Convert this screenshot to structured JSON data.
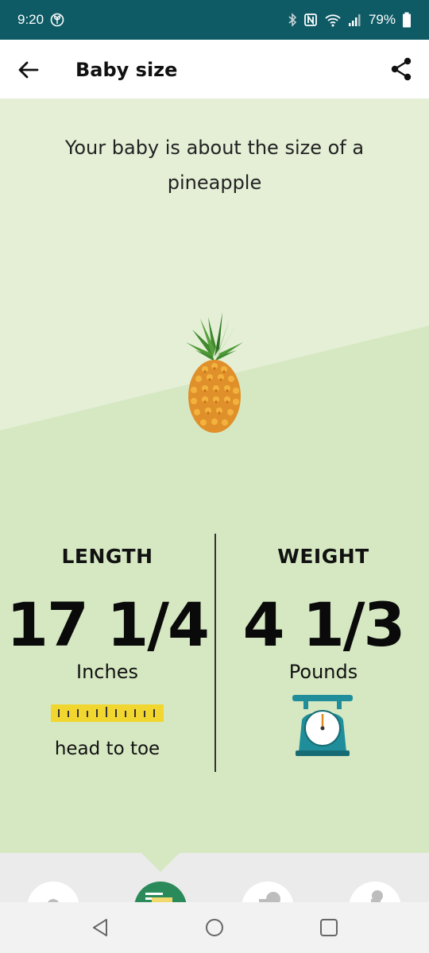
{
  "status_bar": {
    "time": "9:20",
    "battery": "79%"
  },
  "app_bar": {
    "title": "Baby size"
  },
  "hero": {
    "headline": "Your baby is about the size of a pineapple",
    "fruit_icon": "pineapple-icon"
  },
  "length": {
    "label": "LENGTH",
    "value": "17 1/4",
    "unit": "Inches",
    "note": "head to toe",
    "icon": "ruler-icon"
  },
  "weight": {
    "label": "WEIGHT",
    "value": "4 1/3",
    "unit": "Pounds",
    "icon": "scale-icon"
  },
  "colors": {
    "status_bar": "#0e5b66",
    "background_light": "#e4efd6",
    "background": "#d6e8c2",
    "nav_active": "#2b8a5a",
    "ruler": "#f2d630",
    "scale": "#1f8e9a"
  },
  "bottom_nav": {
    "items": [
      "nav-item-1",
      "nav-item-2-active",
      "nav-item-3",
      "nav-item-4"
    ]
  }
}
